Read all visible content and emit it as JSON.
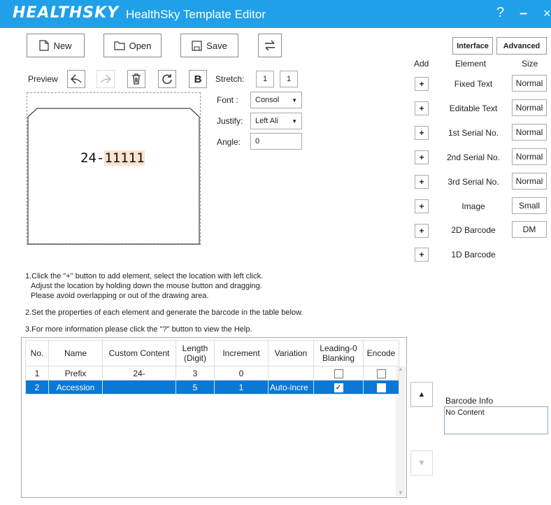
{
  "window": {
    "logo": "HEALTHSKY",
    "title": "HealthSky Template Editor",
    "help": "?",
    "minimize": "–",
    "close": "×"
  },
  "toolbar": {
    "new_label": "New",
    "open_label": "Open",
    "save_label": "Save",
    "swap_icon": "swap-arrows-icon"
  },
  "mode_buttons": {
    "interface": "Interface",
    "advanced": "Advanced"
  },
  "preview": {
    "label": "Preview",
    "bold_label": "B",
    "stretch_label": "Stretch:",
    "stretch_x": "1",
    "stretch_y": "1",
    "font_label": "Font :",
    "font_value": "Consol",
    "justify_label": "Justify:",
    "justify_value": "Left Ali",
    "angle_label": "Angle:",
    "angle_value": "0",
    "canvas_prefix": "24-",
    "canvas_serial": "11111"
  },
  "elements": {
    "headers": {
      "add": "Add",
      "element": "Element",
      "size": "Size"
    },
    "items": [
      {
        "add": "+",
        "name": "Fixed Text",
        "size": "Normal"
      },
      {
        "add": "+",
        "name": "Editable Text",
        "size": "Normal"
      },
      {
        "add": "+",
        "name": "1st Serial No.",
        "size": "Normal"
      },
      {
        "add": "+",
        "name": "2nd Serial No.",
        "size": "Normal"
      },
      {
        "add": "+",
        "name": "3rd Serial No.",
        "size": "Normal"
      },
      {
        "add": "+",
        "name": "Image",
        "size": "Small"
      },
      {
        "add": "+",
        "name": "2D Barcode",
        "size": "DM"
      },
      {
        "add": "+",
        "name": "1D Barcode",
        "size": ""
      }
    ]
  },
  "instructions": {
    "line1": "1.Click the \"+\" button to add element, select the location with left click.",
    "line1b": "Adjust the location by holding down the mouse button and dragging.",
    "line1c": "Please avoid overlapping or out of the drawing area.",
    "line2": "2.Set the properties of each element and generate the barcode in the table below.",
    "line3": "3.For more information please click the \"?\" button to view the Help."
  },
  "table": {
    "headers": {
      "no": "No.",
      "name": "Name",
      "custom": "Custom Content",
      "length1": "Length",
      "length2": "(Digit)",
      "increment": "Increment",
      "variation": "Variation",
      "leading1": "Leading-0",
      "leading2": "Blanking",
      "encode": "Encode"
    },
    "rows": [
      {
        "no": "1",
        "name": "Prefix",
        "custom": "24-",
        "length": "3",
        "increment": "0",
        "variation": "",
        "leading": false,
        "encode": false
      },
      {
        "no": "2",
        "name": "Accession",
        "custom": "",
        "length": "5",
        "increment": "1",
        "variation": "Auto-incre",
        "leading": true,
        "encode": false
      }
    ]
  },
  "barcode_info": {
    "label": "Barcode Info",
    "value": "No Content"
  },
  "colors": {
    "titlebar": "#1fa0e8",
    "selection": "#0a78d4",
    "highlight": "#fbe3cc"
  }
}
